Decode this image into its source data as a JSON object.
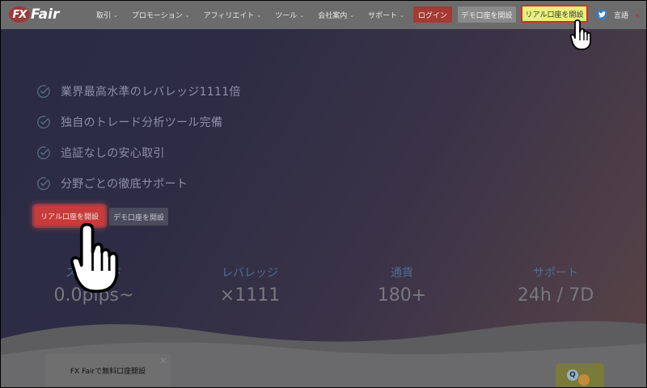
{
  "header": {
    "logo_mark": "FX",
    "logo_text": "Fair",
    "nav": [
      {
        "label": "取引"
      },
      {
        "label": "プロモーション"
      },
      {
        "label": "アフィリエイト"
      },
      {
        "label": "ツール"
      },
      {
        "label": "会社案内"
      },
      {
        "label": "サポート"
      }
    ],
    "login_label": "ログイン",
    "demo_label": "デモ口座を開設",
    "real_label": "リアル口座を開設",
    "language_label": "言語",
    "twitter_icon": "twitter-icon"
  },
  "hero": {
    "features": [
      "業界最高水準のレバレッジ1111倍",
      "独自のトレード分析ツール完備",
      "追証なしの安心取引",
      "分野ごとの徹底サポート"
    ],
    "real_button": "リアル口座を開設",
    "demo_button": "デモ口座を開設"
  },
  "stats": [
    {
      "label": "スプレッド",
      "value": "0.0pips~"
    },
    {
      "label": "レバレッジ",
      "value": "×1111"
    },
    {
      "label": "通貨",
      "value": "180+"
    },
    {
      "label": "サポート",
      "value": "24h / 7D"
    }
  ],
  "promo": {
    "text": "FX Fairで無料口座開設",
    "close": "×"
  },
  "colors": {
    "accent_red": "#c93a3a",
    "highlight_yellow": "#e8f07a",
    "stat_label_blue": "#4e6d94"
  }
}
